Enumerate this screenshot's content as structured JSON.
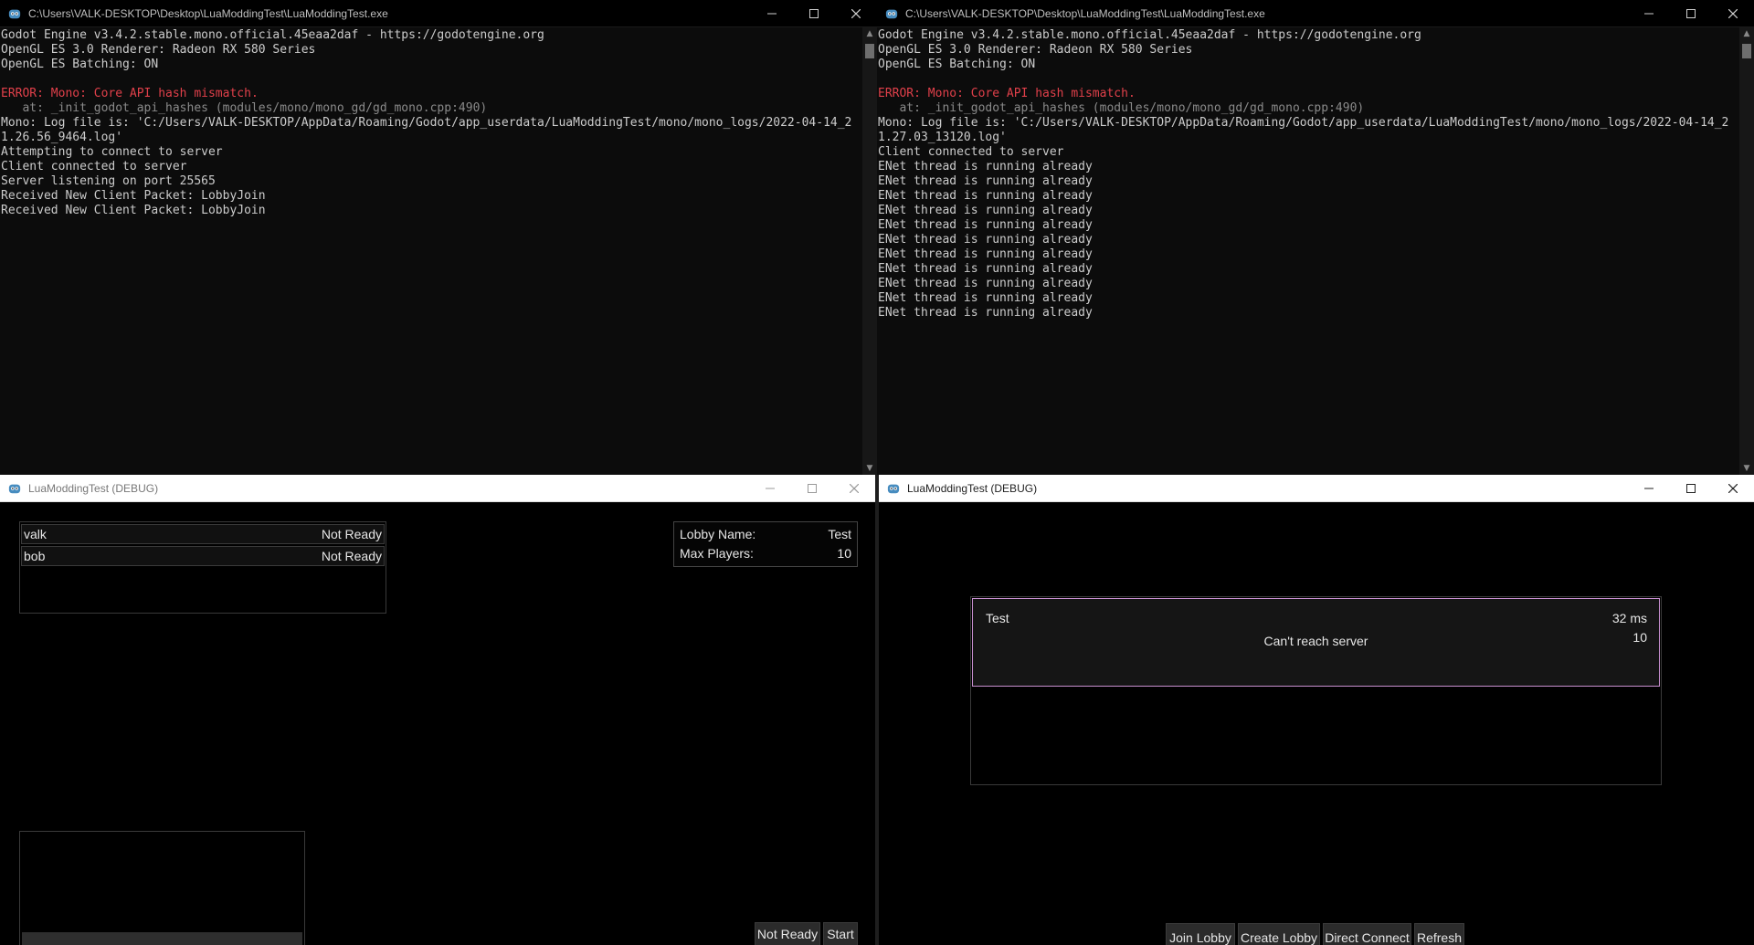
{
  "console_left": {
    "title": "C:\\Users\\VALK-DESKTOP\\Desktop\\LuaModdingTest\\LuaModdingTest.exe",
    "lines": [
      {
        "t": "Godot Engine v3.4.2.stable.mono.official.45eaa2daf - https://godotengine.org"
      },
      {
        "t": "OpenGL ES 3.0 Renderer: Radeon RX 580 Series"
      },
      {
        "t": "OpenGL ES Batching: ON"
      },
      {
        "t": ""
      },
      {
        "t": "ERROR: ",
        "red": "Mono: Core API hash mismatch."
      },
      {
        "g": "   at: _init_godot_api_hashes (modules/mono/mono_gd/gd_mono.cpp:490)"
      },
      {
        "t": "Mono: Log file is: 'C:/Users/VALK-DESKTOP/AppData/Roaming/Godot/app_userdata/LuaModdingTest/mono/mono_logs/2022-04-14_21.26.56_9464.log'"
      },
      {
        "t": "Attempting to connect to server"
      },
      {
        "t": "Client connected to server"
      },
      {
        "t": "Server listening on port 25565"
      },
      {
        "t": "Received New Client Packet: LobbyJoin"
      },
      {
        "t": "Received New Client Packet: LobbyJoin"
      }
    ]
  },
  "console_right": {
    "title": "C:\\Users\\VALK-DESKTOP\\Desktop\\LuaModdingTest\\LuaModdingTest.exe",
    "lines": [
      {
        "t": "Godot Engine v3.4.2.stable.mono.official.45eaa2daf - https://godotengine.org"
      },
      {
        "t": "OpenGL ES 3.0 Renderer: Radeon RX 580 Series"
      },
      {
        "t": "OpenGL ES Batching: ON"
      },
      {
        "t": ""
      },
      {
        "t": "ERROR: ",
        "red": "Mono: Core API hash mismatch."
      },
      {
        "g": "   at: _init_godot_api_hashes (modules/mono/mono_gd/gd_mono.cpp:490)"
      },
      {
        "t": "Mono: Log file is: 'C:/Users/VALK-DESKTOP/AppData/Roaming/Godot/app_userdata/LuaModdingTest/mono/mono_logs/2022-04-14_21.27.03_13120.log'"
      },
      {
        "t": "Client connected to server"
      },
      {
        "t": "ENet thread is running already"
      },
      {
        "t": "ENet thread is running already"
      },
      {
        "t": "ENet thread is running already"
      },
      {
        "t": "ENet thread is running already"
      },
      {
        "t": "ENet thread is running already"
      },
      {
        "t": "ENet thread is running already"
      },
      {
        "t": "ENet thread is running already"
      },
      {
        "t": "ENet thread is running already"
      },
      {
        "t": "ENet thread is running already"
      },
      {
        "t": "ENet thread is running already"
      },
      {
        "t": "ENet thread is running already"
      }
    ]
  },
  "lobby_window": {
    "title": "LuaModdingTest (DEBUG)",
    "players": [
      {
        "name": "valk",
        "status": "Not Ready"
      },
      {
        "name": "bob",
        "status": "Not Ready"
      }
    ],
    "info": {
      "lobby_name_label": "Lobby Name:",
      "lobby_name_value": "Test",
      "max_players_label": "Max Players:",
      "max_players_value": "10"
    },
    "ready_button": "Not Ready",
    "start_button": "Start"
  },
  "browser_window": {
    "title": "LuaModdingTest (DEBUG)",
    "lobby": {
      "name": "Test",
      "ping": "32 ms",
      "status": "Can't reach server",
      "max_players": "10"
    },
    "buttons": {
      "join": "Join Lobby",
      "create": "Create Lobby",
      "direct": "Direct Connect",
      "refresh": "Refresh"
    },
    "colors": {
      "selected_border": "#c88fd0"
    }
  }
}
